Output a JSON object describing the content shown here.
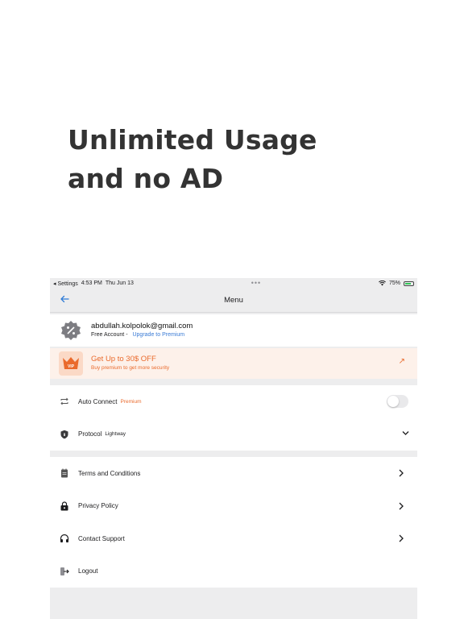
{
  "promo": {
    "line1": "Unlimited Usage",
    "line2": "and no AD"
  },
  "statusbar": {
    "back_app": "◂ Settings",
    "time": "4:53 PM",
    "date": "Thu Jun 13",
    "dots": "•••",
    "battery": "75%"
  },
  "navbar": {
    "back_icon": "arrow-left",
    "title": "Menu"
  },
  "account": {
    "email": "abdullah.kolpolok@gmail.com",
    "plan": "Free Account -",
    "upgrade_link": "Upgrade to Premium"
  },
  "offer": {
    "badge": "VIP",
    "headline": "Get Up to 30$ OFF",
    "tagline": "Buy premium to get more security",
    "accent": "#ea6a2c"
  },
  "settings": {
    "auto_connect": {
      "label": "Auto Connect",
      "tag": "Premium",
      "enabled": false
    },
    "protocol": {
      "label": "Protocol",
      "value": "Lightway"
    }
  },
  "menu": {
    "terms": "Terms and Conditions",
    "privacy": "Privacy Policy",
    "support": "Contact Support",
    "logout": "Logout"
  },
  "colors": {
    "link": "#3a7bd5",
    "background": "#ededee"
  }
}
